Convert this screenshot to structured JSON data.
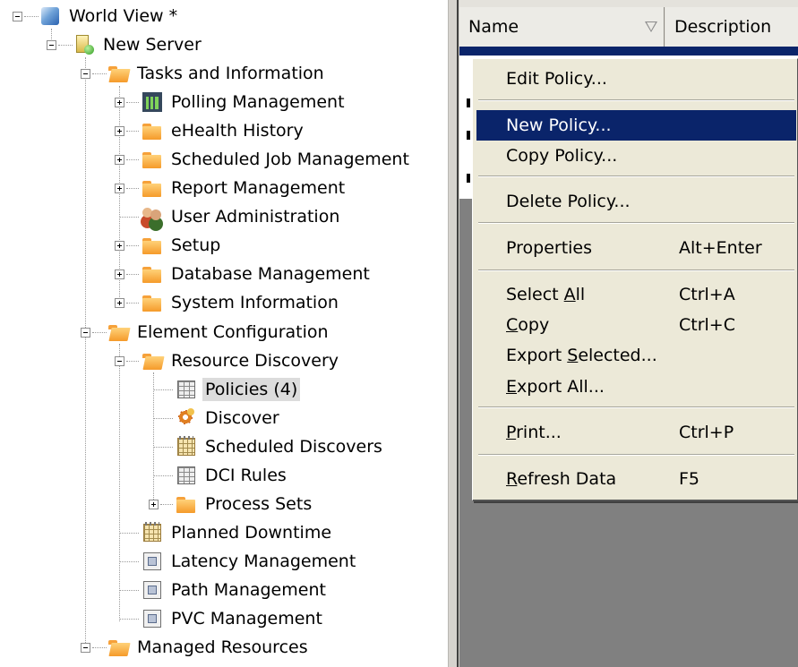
{
  "tree": {
    "nodes": [
      {
        "label": "World View  *",
        "icon": "globe-icon"
      },
      {
        "label": "New Server",
        "icon": "server-icon"
      },
      {
        "label": "Tasks and Information",
        "icon": "folder-open-icon"
      },
      {
        "label": "Polling Management",
        "icon": "chart-icon"
      },
      {
        "label": "eHealth History",
        "icon": "folder-icon"
      },
      {
        "label": "Scheduled Job Management",
        "icon": "folder-icon"
      },
      {
        "label": "Report Management",
        "icon": "folder-icon"
      },
      {
        "label": "User Administration",
        "icon": "users-icon"
      },
      {
        "label": "Setup",
        "icon": "folder-icon"
      },
      {
        "label": "Database Management",
        "icon": "folder-icon"
      },
      {
        "label": "System Information",
        "icon": "folder-icon"
      },
      {
        "label": "Element Configuration",
        "icon": "folder-open-icon"
      },
      {
        "label": "Resource Discovery",
        "icon": "folder-open-icon"
      },
      {
        "label": "Policies (4)",
        "icon": "table-icon",
        "selected": true
      },
      {
        "label": "Discover",
        "icon": "gear-icon"
      },
      {
        "label": "Scheduled Discovers",
        "icon": "calendar-icon"
      },
      {
        "label": "DCI Rules",
        "icon": "table-icon"
      },
      {
        "label": "Process Sets",
        "icon": "folder-icon"
      },
      {
        "label": "Planned Downtime",
        "icon": "calendar-icon"
      },
      {
        "label": "Latency Management",
        "icon": "panel-icon"
      },
      {
        "label": "Path Management",
        "icon": "panel-icon"
      },
      {
        "label": "PVC Management",
        "icon": "panel-icon"
      },
      {
        "label": "Managed Resources",
        "icon": "folder-open-icon"
      }
    ]
  },
  "table": {
    "columns": [
      "Name",
      "Description"
    ]
  },
  "context_menu": {
    "items": [
      {
        "pre": "Edit Policy...",
        "key": "",
        "post": "",
        "shortcut": ""
      },
      {
        "pre": "New Policy...",
        "key": "",
        "post": "",
        "shortcut": "",
        "highlighted": true
      },
      {
        "pre": "Copy Policy...",
        "key": "",
        "post": "",
        "shortcut": ""
      },
      {
        "pre": "Delete Policy...",
        "key": "",
        "post": "",
        "shortcut": ""
      },
      {
        "pre": "Properties",
        "key": "",
        "post": "",
        "shortcut": "Alt+Enter"
      },
      {
        "pre": "Select ",
        "key": "A",
        "post": "ll",
        "shortcut": "Ctrl+A"
      },
      {
        "pre": "",
        "key": "C",
        "post": "opy",
        "shortcut": "Ctrl+C"
      },
      {
        "pre": "Export ",
        "key": "S",
        "post": "elected...",
        "shortcut": ""
      },
      {
        "pre": "",
        "key": "E",
        "post": "xport All...",
        "shortcut": ""
      },
      {
        "pre": "",
        "key": "P",
        "post": "rint...",
        "shortcut": "Ctrl+P"
      },
      {
        "pre": "",
        "key": "R",
        "post": "efresh Data",
        "shortcut": "F5"
      }
    ]
  },
  "colors": {
    "menu_background": "#ece9d8",
    "menu_highlight": "#0a246a",
    "tree_selection": "#dcdcdc",
    "folder": "#f59a2a",
    "pane_background": "#808080"
  }
}
